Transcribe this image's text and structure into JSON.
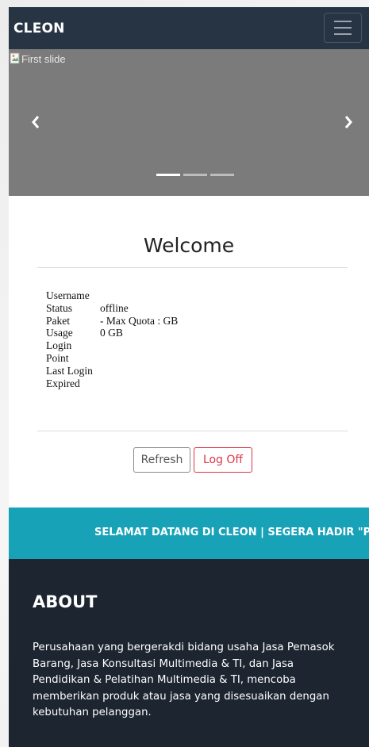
{
  "navbar": {
    "brand": "CLEON",
    "toggler_icon": "hamburger-icon"
  },
  "carousel": {
    "image_alt": "First slide",
    "prev_icon": "chevron-left-icon",
    "next_icon": "chevron-right-icon",
    "indicators": 3,
    "active_indicator": 0
  },
  "welcome": {
    "title": "Welcome",
    "rows": [
      {
        "label": "Username",
        "value": ""
      },
      {
        "label": "Status",
        "value": "offline"
      },
      {
        "label": "Paket",
        "value": "- Max Quota : GB"
      },
      {
        "label": "Usage",
        "value": "0 GB"
      },
      {
        "label": "Login",
        "value": ""
      },
      {
        "label": "Point",
        "value": ""
      },
      {
        "label": "Last Login",
        "value": ""
      },
      {
        "label": "Expired",
        "value": ""
      }
    ],
    "refresh_label": "Refresh",
    "logoff_label": "Log Off"
  },
  "marquee": {
    "text": "SELAMAT DATANG DI CLEON | SEGERA HADIR \"PI"
  },
  "about": {
    "title": "ABOUT",
    "text": "Perusahaan yang bergerakdi bidang usaha Jasa Pemasok Barang, Jasa Konsultasi Multimedia & TI, dan Jasa Pendidikan & Pelatihan Multimedia & TI, mencoba memberikan produk atau jasa yang disesuaikan dengan kebutuhan pelanggan."
  },
  "colors": {
    "navbar": "#273444",
    "carousel": "#7b7b7b",
    "marquee": "#18a2b8",
    "about": "#1c2530",
    "danger": "#dc3545"
  }
}
